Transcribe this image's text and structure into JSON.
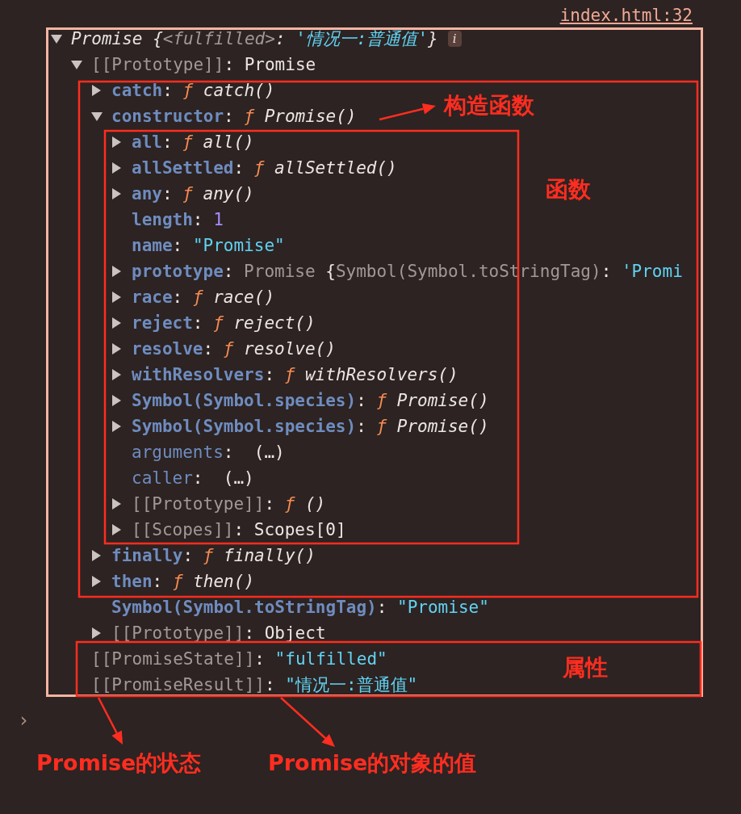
{
  "link": "index.html:32",
  "root": {
    "expanded": true,
    "badge": "i",
    "value": [
      {
        "text": "Promise {",
        "kind": "title"
      },
      {
        "text": "<fulfilled>",
        "kind": "title_dim"
      },
      {
        "text": ": ",
        "kind": "title"
      },
      {
        "text": "'情况一:普通值'",
        "kind": "title_string"
      },
      {
        "text": "}",
        "kind": "title"
      }
    ],
    "children": [
      {
        "key": {
          "text": "[[Prototype]]",
          "kind": "internal"
        },
        "expandable": true,
        "expanded": true,
        "value": [
          {
            "text": ": ",
            "kind": "plain"
          },
          {
            "text": "Promise",
            "kind": "plain"
          }
        ],
        "children": [
          {
            "key": {
              "text": "catch",
              "kind": "own"
            },
            "expandable": true,
            "expanded": false,
            "value": [
              {
                "text": ": ",
                "kind": "plain"
              },
              {
                "text": "ƒ ",
                "kind": "fn_mark"
              },
              {
                "text": "catch()",
                "kind": "fn_name"
              }
            ]
          },
          {
            "key": {
              "text": "constructor",
              "kind": "own"
            },
            "expandable": true,
            "expanded": true,
            "value": [
              {
                "text": ": ",
                "kind": "plain"
              },
              {
                "text": "ƒ ",
                "kind": "fn_mark"
              },
              {
                "text": "Promise()",
                "kind": "fn_name"
              }
            ],
            "children": [
              {
                "key": {
                  "text": "all",
                  "kind": "own"
                },
                "expandable": true,
                "expanded": false,
                "value": [
                  {
                    "text": ": ",
                    "kind": "plain"
                  },
                  {
                    "text": "ƒ ",
                    "kind": "fn_mark"
                  },
                  {
                    "text": "all()",
                    "kind": "fn_name"
                  }
                ]
              },
              {
                "key": {
                  "text": "allSettled",
                  "kind": "own"
                },
                "expandable": true,
                "expanded": false,
                "value": [
                  {
                    "text": ": ",
                    "kind": "plain"
                  },
                  {
                    "text": "ƒ ",
                    "kind": "fn_mark"
                  },
                  {
                    "text": "allSettled()",
                    "kind": "fn_name"
                  }
                ]
              },
              {
                "key": {
                  "text": "any",
                  "kind": "own"
                },
                "expandable": true,
                "expanded": false,
                "value": [
                  {
                    "text": ": ",
                    "kind": "plain"
                  },
                  {
                    "text": "ƒ ",
                    "kind": "fn_mark"
                  },
                  {
                    "text": "any()",
                    "kind": "fn_name"
                  }
                ]
              },
              {
                "key": {
                  "text": "length",
                  "kind": "own"
                },
                "expandable": false,
                "value": [
                  {
                    "text": ": ",
                    "kind": "plain"
                  },
                  {
                    "text": "1",
                    "kind": "number"
                  }
                ]
              },
              {
                "key": {
                  "text": "name",
                  "kind": "own"
                },
                "expandable": false,
                "value": [
                  {
                    "text": ": ",
                    "kind": "plain"
                  },
                  {
                    "text": "\"Promise\"",
                    "kind": "string"
                  }
                ]
              },
              {
                "key": {
                  "text": "prototype",
                  "kind": "own"
                },
                "expandable": true,
                "expanded": false,
                "value": [
                  {
                    "text": ": ",
                    "kind": "plain"
                  },
                  {
                    "text": "Promise ",
                    "kind": "dim"
                  },
                  {
                    "text": "{",
                    "kind": "plain"
                  },
                  {
                    "text": "Symbol(Symbol.toStringTag)",
                    "kind": "dim"
                  },
                  {
                    "text": ": ",
                    "kind": "plain"
                  },
                  {
                    "text": "'Promi",
                    "kind": "string"
                  }
                ]
              },
              {
                "key": {
                  "text": "race",
                  "kind": "own"
                },
                "expandable": true,
                "expanded": false,
                "value": [
                  {
                    "text": ": ",
                    "kind": "plain"
                  },
                  {
                    "text": "ƒ ",
                    "kind": "fn_mark"
                  },
                  {
                    "text": "race()",
                    "kind": "fn_name"
                  }
                ]
              },
              {
                "key": {
                  "text": "reject",
                  "kind": "own"
                },
                "expandable": true,
                "expanded": false,
                "value": [
                  {
                    "text": ": ",
                    "kind": "plain"
                  },
                  {
                    "text": "ƒ ",
                    "kind": "fn_mark"
                  },
                  {
                    "text": "reject()",
                    "kind": "fn_name"
                  }
                ]
              },
              {
                "key": {
                  "text": "resolve",
                  "kind": "own"
                },
                "expandable": true,
                "expanded": false,
                "value": [
                  {
                    "text": ": ",
                    "kind": "plain"
                  },
                  {
                    "text": "ƒ ",
                    "kind": "fn_mark"
                  },
                  {
                    "text": "resolve()",
                    "kind": "fn_name"
                  }
                ]
              },
              {
                "key": {
                  "text": "withResolvers",
                  "kind": "own"
                },
                "expandable": true,
                "expanded": false,
                "value": [
                  {
                    "text": ": ",
                    "kind": "plain"
                  },
                  {
                    "text": "ƒ ",
                    "kind": "fn_mark"
                  },
                  {
                    "text": "withResolvers()",
                    "kind": "fn_name"
                  }
                ]
              },
              {
                "key": {
                  "text": "Symbol(Symbol.species)",
                  "kind": "own"
                },
                "expandable": true,
                "expanded": false,
                "value": [
                  {
                    "text": ": ",
                    "kind": "plain"
                  },
                  {
                    "text": "ƒ ",
                    "kind": "fn_mark"
                  },
                  {
                    "text": "Promise()",
                    "kind": "fn_name"
                  }
                ]
              },
              {
                "key": {
                  "text": "Symbol(Symbol.species)",
                  "kind": "own"
                },
                "expandable": true,
                "expanded": false,
                "value": [
                  {
                    "text": ": ",
                    "kind": "plain"
                  },
                  {
                    "text": "ƒ ",
                    "kind": "fn_mark"
                  },
                  {
                    "text": "Promise()",
                    "kind": "fn_name"
                  }
                ]
              },
              {
                "key": {
                  "text": "arguments",
                  "kind": "accessor"
                },
                "expandable": false,
                "value": [
                  {
                    "text": ":  ",
                    "kind": "plain"
                  },
                  {
                    "text": "(…)",
                    "kind": "plain"
                  }
                ]
              },
              {
                "key": {
                  "text": "caller",
                  "kind": "accessor"
                },
                "expandable": false,
                "value": [
                  {
                    "text": ":  ",
                    "kind": "plain"
                  },
                  {
                    "text": "(…)",
                    "kind": "plain"
                  }
                ]
              },
              {
                "key": {
                  "text": "[[Prototype]]",
                  "kind": "internal"
                },
                "expandable": true,
                "expanded": false,
                "value": [
                  {
                    "text": ": ",
                    "kind": "plain"
                  },
                  {
                    "text": "ƒ ",
                    "kind": "fn_mark"
                  },
                  {
                    "text": "()",
                    "kind": "fn_name"
                  }
                ]
              },
              {
                "key": {
                  "text": "[[Scopes]]",
                  "kind": "internal"
                },
                "expandable": true,
                "expanded": false,
                "value": [
                  {
                    "text": ": ",
                    "kind": "plain"
                  },
                  {
                    "text": "Scopes[0]",
                    "kind": "plain"
                  }
                ]
              }
            ]
          },
          {
            "key": {
              "text": "finally",
              "kind": "own"
            },
            "expandable": true,
            "expanded": false,
            "value": [
              {
                "text": ": ",
                "kind": "plain"
              },
              {
                "text": "ƒ ",
                "kind": "fn_mark"
              },
              {
                "text": "finally()",
                "kind": "fn_name"
              }
            ]
          },
          {
            "key": {
              "text": "then",
              "kind": "own"
            },
            "expandable": true,
            "expanded": false,
            "value": [
              {
                "text": ": ",
                "kind": "plain"
              },
              {
                "text": "ƒ ",
                "kind": "fn_mark"
              },
              {
                "text": "then()",
                "kind": "fn_name"
              }
            ]
          },
          {
            "key": {
              "text": "Symbol(Symbol.toStringTag)",
              "kind": "own"
            },
            "expandable": false,
            "value": [
              {
                "text": ": ",
                "kind": "plain"
              },
              {
                "text": "\"Promise\"",
                "kind": "string"
              }
            ]
          },
          {
            "key": {
              "text": "[[Prototype]]",
              "kind": "internal"
            },
            "expandable": true,
            "expanded": false,
            "value": [
              {
                "text": ": ",
                "kind": "plain"
              },
              {
                "text": "Object",
                "kind": "plain"
              }
            ]
          }
        ]
      },
      {
        "key": {
          "text": "[[PromiseState]]",
          "kind": "internal"
        },
        "expandable": false,
        "value": [
          {
            "text": ": ",
            "kind": "plain"
          },
          {
            "text": "\"fulfilled\"",
            "kind": "string"
          }
        ]
      },
      {
        "key": {
          "text": "[[PromiseResult]]",
          "kind": "internal"
        },
        "expandable": false,
        "value": [
          {
            "text": ": ",
            "kind": "plain"
          },
          {
            "text": "\"情况一:普通值\"",
            "kind": "string"
          }
        ]
      }
    ]
  },
  "prompt": "›",
  "annotations": [
    {
      "text": "构造函数"
    },
    {
      "text": "函数"
    },
    {
      "text": "属性"
    },
    {
      "text": "Promise的状态"
    },
    {
      "text": "Promise的对象的值"
    }
  ]
}
